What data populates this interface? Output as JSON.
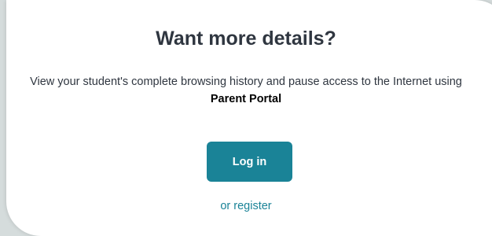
{
  "panel": {
    "heading": "Want more details?",
    "description": "View your student's complete browsing history and pause access to the Internet using",
    "description_emphasis": "Parent Portal",
    "login_label": "Log in",
    "register_label": "or register"
  },
  "colors": {
    "background": "#d5dcdc",
    "card": "#ffffff",
    "heading_text": "#2f3640",
    "accent": "#1a8397"
  }
}
